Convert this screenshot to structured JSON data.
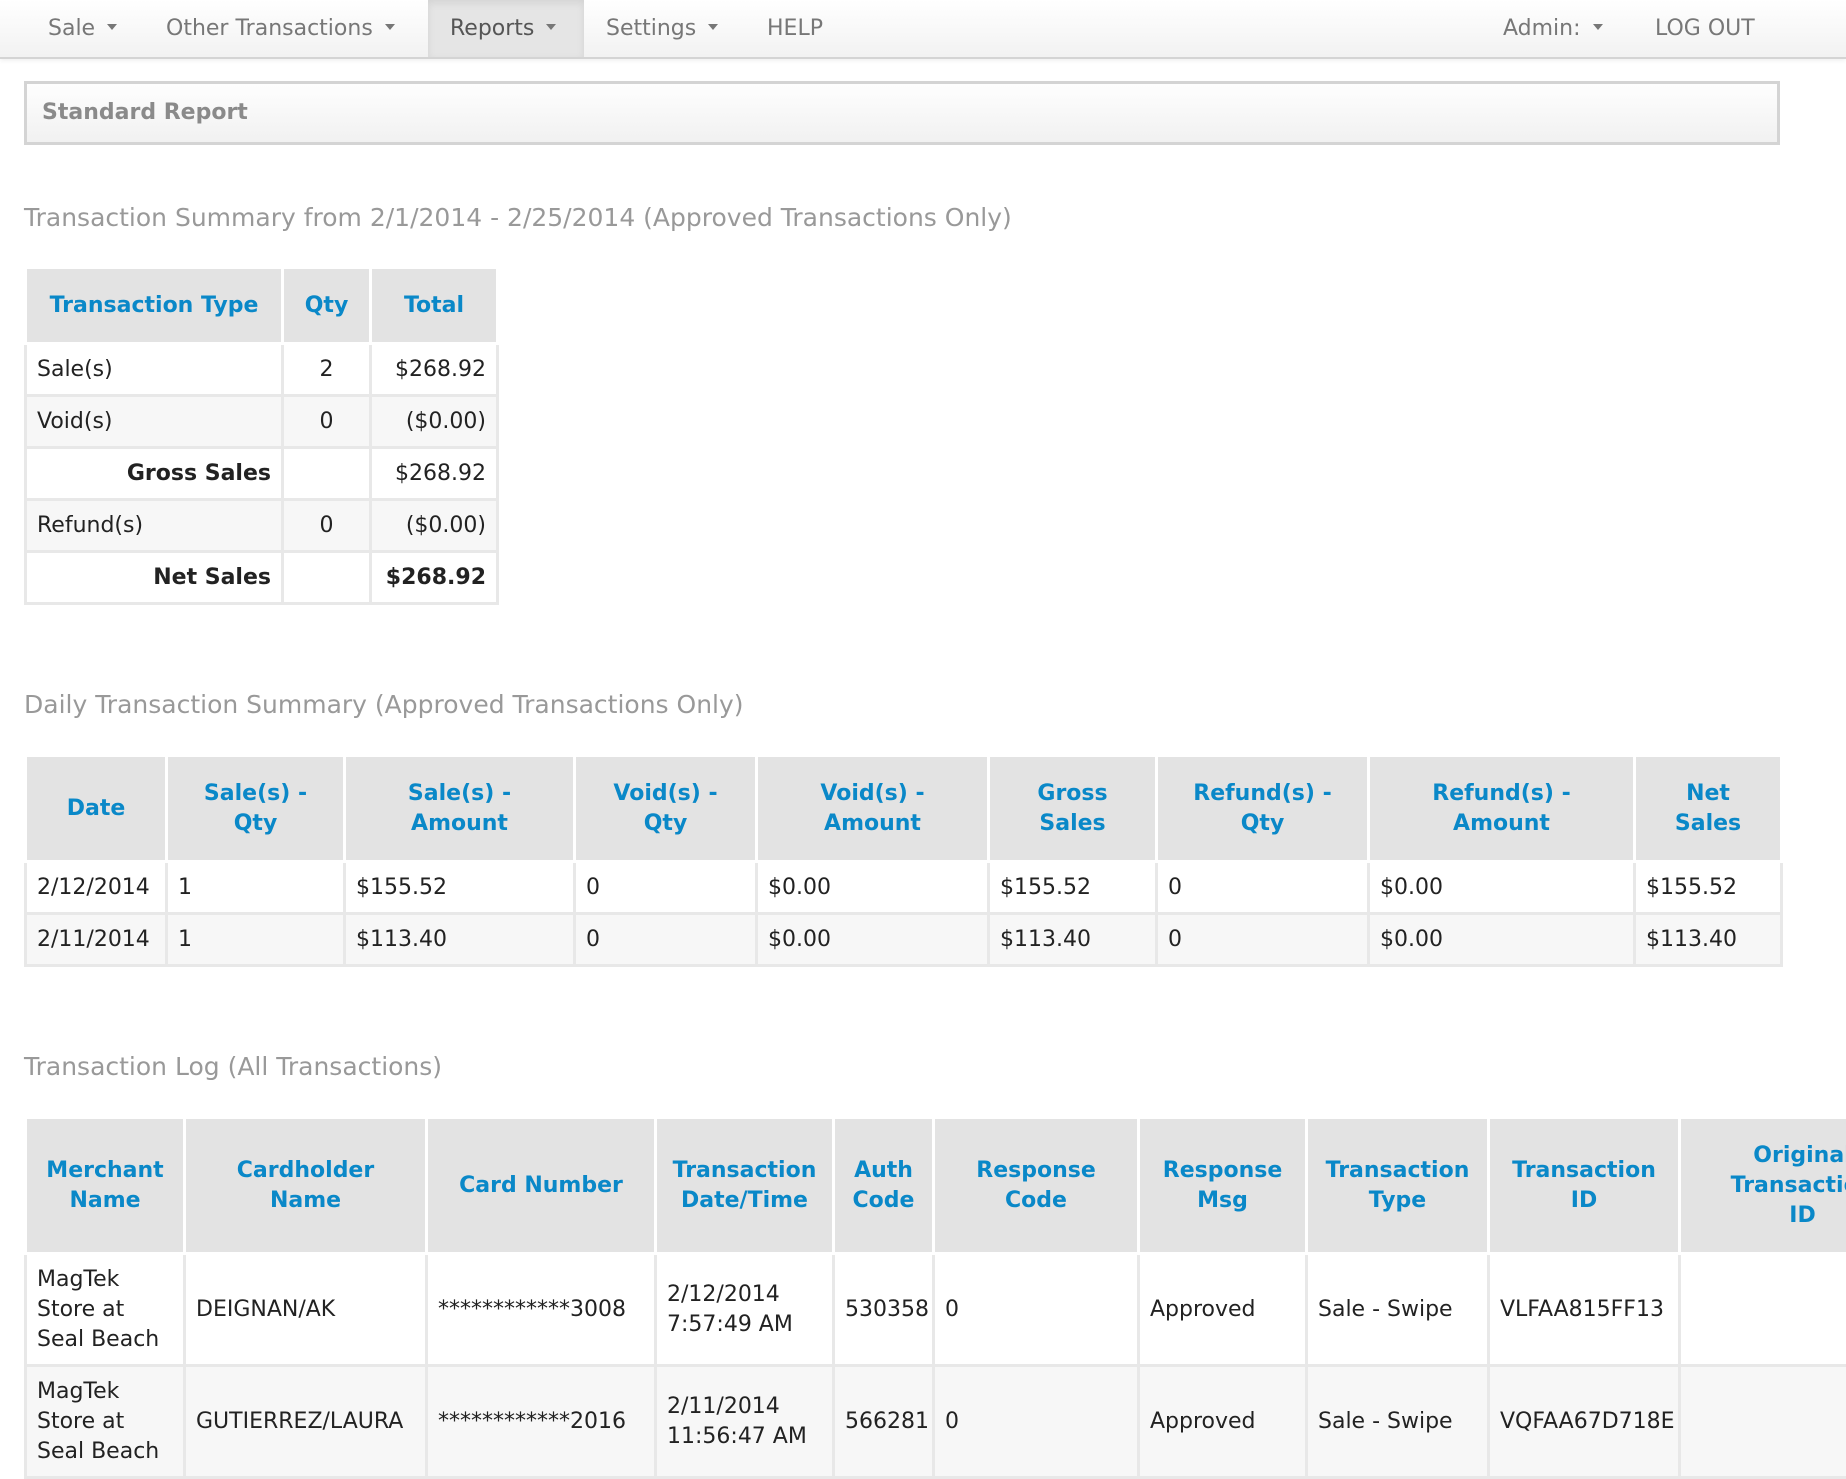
{
  "nav": {
    "items": [
      {
        "label": "Sale",
        "has_caret": true
      },
      {
        "label": "Other Transactions",
        "has_caret": true
      },
      {
        "label": "Reports",
        "has_caret": true,
        "active": true
      },
      {
        "label": "Settings",
        "has_caret": true
      },
      {
        "label": "HELP",
        "has_caret": false
      }
    ],
    "admin_label": "Admin:",
    "logout_label": "LOG OUT"
  },
  "report": {
    "title": "Standard Report"
  },
  "summary": {
    "heading": "Transaction Summary from 2/1/2014 - 2/25/2014 (Approved Transactions Only)",
    "columns": [
      "Transaction Type",
      "Qty",
      "Total"
    ],
    "rows": [
      {
        "type": "Sale(s)",
        "qty": "2",
        "total": "$268.92"
      },
      {
        "type": "Void(s)",
        "qty": "0",
        "total": "($0.00)"
      },
      {
        "type": "Gross Sales",
        "qty": "",
        "total": "$268.92"
      },
      {
        "type": "Refund(s)",
        "qty": "0",
        "total": "($0.00)"
      },
      {
        "type": "Net Sales",
        "qty": "",
        "total": "$268.92"
      }
    ]
  },
  "daily": {
    "heading": "Daily Transaction Summary (Approved Transactions Only)",
    "columns": [
      [
        "Date"
      ],
      [
        "Sale(s) -",
        "Qty"
      ],
      [
        "Sale(s) -",
        "Amount"
      ],
      [
        "Void(s) -",
        "Qty"
      ],
      [
        "Void(s) -",
        "Amount"
      ],
      [
        "Gross",
        "Sales"
      ],
      [
        "Refund(s) -",
        "Qty"
      ],
      [
        "Refund(s) -",
        "Amount"
      ],
      [
        "Net",
        "Sales"
      ]
    ],
    "rows": [
      [
        "2/12/2014",
        "1",
        "$155.52",
        "0",
        "$0.00",
        "$155.52",
        "0",
        "$0.00",
        "$155.52"
      ],
      [
        "2/11/2014",
        "1",
        "$113.40",
        "0",
        "$0.00",
        "$113.40",
        "0",
        "$0.00",
        "$113.40"
      ]
    ]
  },
  "log": {
    "heading": "Transaction Log (All Transactions)",
    "columns": [
      [
        "Merchant",
        "Name"
      ],
      [
        "Cardholder",
        "Name"
      ],
      [
        "Card Number"
      ],
      [
        "Transaction",
        "Date/Time"
      ],
      [
        "Auth",
        "Code"
      ],
      [
        "Response",
        "Code"
      ],
      [
        "Response",
        "Msg"
      ],
      [
        "Transaction",
        "Type"
      ],
      [
        "Transaction",
        "ID"
      ],
      [
        "Original",
        "Transaction",
        "ID"
      ]
    ],
    "rows": [
      {
        "merchant": [
          "MagTek",
          "Store at",
          "Seal Beach"
        ],
        "cardholder": "DEIGNAN/AK",
        "card_number": "************3008",
        "datetime": [
          "2/12/2014",
          "7:57:49 AM"
        ],
        "auth_code": "530358",
        "response_code": "0",
        "response_msg": "Approved",
        "txn_type": "Sale - Swipe",
        "txn_id": "VLFAA815FF13",
        "original_txn_id": ""
      },
      {
        "merchant": [
          "MagTek",
          "Store at",
          "Seal Beach"
        ],
        "cardholder": "GUTIERREZ/LAURA",
        "card_number": "************2016",
        "datetime": [
          "2/11/2014",
          "11:56:47 AM"
        ],
        "auth_code": "566281",
        "response_code": "0",
        "response_msg": "Approved",
        "txn_type": "Sale - Swipe",
        "txn_id": "VQFAA67D718E",
        "original_txn_id": ""
      }
    ]
  },
  "colors": {
    "header_text": "#0a88c8",
    "header_bg": "#e3e3e3",
    "heading_grey": "#999999"
  }
}
